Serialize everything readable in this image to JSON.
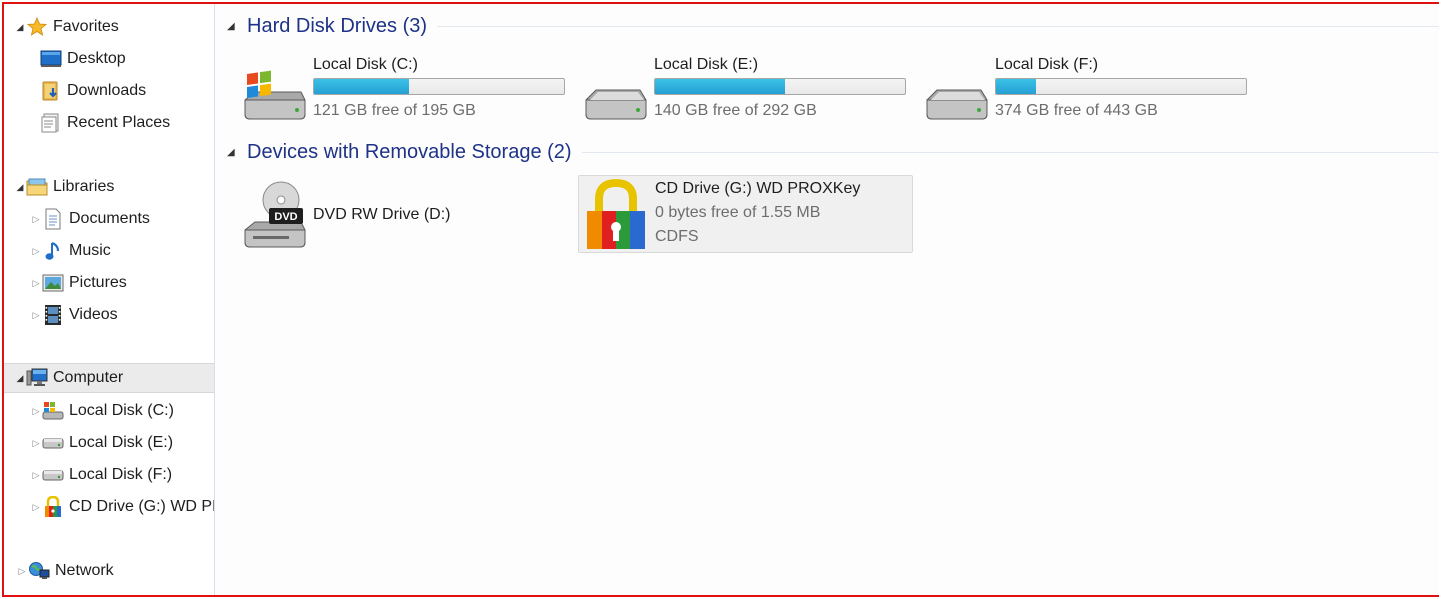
{
  "sidebar": {
    "favorites": {
      "label": "Favorites",
      "icon": "star-icon",
      "items": [
        {
          "label": "Desktop",
          "icon": "desktop-icon"
        },
        {
          "label": "Downloads",
          "icon": "downloads-icon"
        },
        {
          "label": "Recent Places",
          "icon": "recent-places-icon"
        }
      ]
    },
    "libraries": {
      "label": "Libraries",
      "icon": "libraries-icon",
      "items": [
        {
          "label": "Documents",
          "icon": "documents-icon"
        },
        {
          "label": "Music",
          "icon": "music-icon"
        },
        {
          "label": "Pictures",
          "icon": "pictures-icon"
        },
        {
          "label": "Videos",
          "icon": "videos-icon"
        }
      ]
    },
    "computer": {
      "label": "Computer",
      "icon": "computer-icon",
      "items": [
        {
          "label": "Local Disk (C:)",
          "icon": "windows-drive-icon"
        },
        {
          "label": "Local Disk (E:)",
          "icon": "hard-drive-icon"
        },
        {
          "label": "Local Disk (F:)",
          "icon": "hard-drive-icon"
        },
        {
          "label": "CD Drive (G:) WD PR",
          "icon": "lock-drive-icon"
        }
      ]
    },
    "network": {
      "label": "Network",
      "icon": "network-icon"
    }
  },
  "main": {
    "hdd_group": {
      "title": "Hard Disk Drives (3)",
      "drives": [
        {
          "name": "Local Disk (C:)",
          "free_text": "121 GB free of 195 GB",
          "used_fraction": 0.38
        },
        {
          "name": "Local Disk (E:)",
          "free_text": "140 GB free of 292 GB",
          "used_fraction": 0.52
        },
        {
          "name": "Local Disk (F:)",
          "free_text": "374 GB free of 443 GB",
          "used_fraction": 0.16
        }
      ]
    },
    "removable_group": {
      "title": "Devices with Removable Storage (2)",
      "devices": [
        {
          "name": "DVD RW Drive (D:)",
          "icon_text": "DVD"
        },
        {
          "name": "CD Drive (G:) WD PROXKey",
          "free_text": "0 bytes free of 1.55 MB",
          "fs": "CDFS"
        }
      ]
    }
  },
  "colors": {
    "accent_border": "#e01010",
    "group_title": "#1e3287",
    "bar_fill": "#26a0d4"
  }
}
